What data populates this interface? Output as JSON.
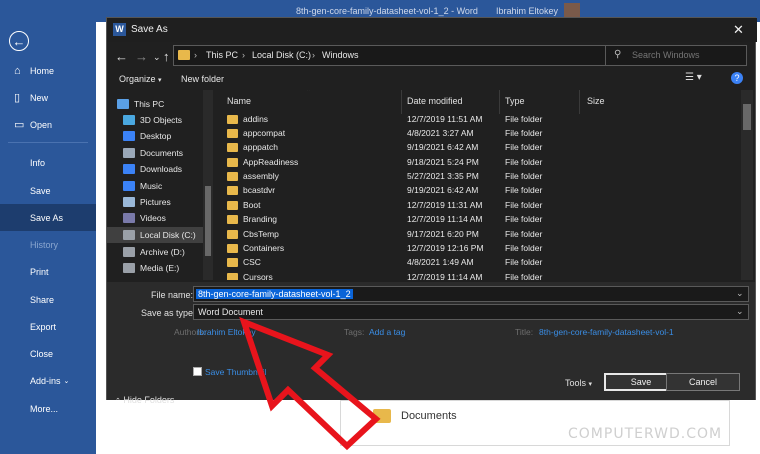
{
  "backstage": {
    "items": [
      {
        "label": "Home",
        "icon": "home-icon"
      },
      {
        "label": "New",
        "icon": "new-doc-icon"
      },
      {
        "label": "Open",
        "icon": "folder-open-icon"
      },
      {
        "label": "Info"
      },
      {
        "label": "Save"
      },
      {
        "label": "Save As"
      },
      {
        "label": "History"
      },
      {
        "label": "Print"
      },
      {
        "label": "Share"
      },
      {
        "label": "Export"
      },
      {
        "label": "Close"
      },
      {
        "label": "Add-ins"
      },
      {
        "label": "More..."
      }
    ],
    "active": "Save As",
    "accent": "#2b579a"
  },
  "word": {
    "doc_title": "8th-gen-core-family-datasheet-vol-1_2 - Word",
    "user": "Ibrahim Eltokey",
    "documents_label": "Documents"
  },
  "watermark": "COMPUTERWD.COM",
  "dialog": {
    "title": "Save As",
    "breadcrumb": [
      "This PC",
      "Local Disk (C:)",
      "Windows"
    ],
    "search_placeholder": "Search Windows",
    "organize": "Organize",
    "new_folder": "New folder",
    "nav": [
      {
        "label": "This PC",
        "color": "#5aa0e6"
      },
      {
        "label": "3D Objects",
        "color": "#4aa8e0"
      },
      {
        "label": "Desktop",
        "color": "#3b82f6"
      },
      {
        "label": "Documents",
        "color": "#9aa8b8"
      },
      {
        "label": "Downloads",
        "color": "#3b82f6"
      },
      {
        "label": "Music",
        "color": "#3b82f6"
      },
      {
        "label": "Pictures",
        "color": "#9ab8d8"
      },
      {
        "label": "Videos",
        "color": "#7a7aaa"
      },
      {
        "label": "Local Disk (C:)",
        "color": "#9aa0a8"
      },
      {
        "label": "Archive (D:)",
        "color": "#9aa0a8"
      },
      {
        "label": "Media (E:)",
        "color": "#9aa0a8"
      }
    ],
    "selected_nav": "Local Disk (C:)",
    "columns": [
      "Name",
      "Date modified",
      "Type",
      "Size"
    ],
    "files": [
      {
        "name": "addins",
        "date": "12/7/2019 11:51 AM",
        "type": "File folder"
      },
      {
        "name": "appcompat",
        "date": "4/8/2021 3:27 AM",
        "type": "File folder"
      },
      {
        "name": "apppatch",
        "date": "9/19/2021 6:42 AM",
        "type": "File folder"
      },
      {
        "name": "AppReadiness",
        "date": "9/18/2021 5:24 PM",
        "type": "File folder"
      },
      {
        "name": "assembly",
        "date": "5/27/2021 3:35 PM",
        "type": "File folder"
      },
      {
        "name": "bcastdvr",
        "date": "9/19/2021 6:42 AM",
        "type": "File folder"
      },
      {
        "name": "Boot",
        "date": "12/7/2019 11:31 AM",
        "type": "File folder"
      },
      {
        "name": "Branding",
        "date": "12/7/2019 11:14 AM",
        "type": "File folder"
      },
      {
        "name": "CbsTemp",
        "date": "9/17/2021 6:20 PM",
        "type": "File folder"
      },
      {
        "name": "Containers",
        "date": "12/7/2019 12:16 PM",
        "type": "File folder"
      },
      {
        "name": "CSC",
        "date": "4/8/2021 1:49 AM",
        "type": "File folder"
      },
      {
        "name": "Cursors",
        "date": "12/7/2019 11:14 AM",
        "type": "File folder"
      }
    ],
    "file_name_label": "File name:",
    "file_name": "8th-gen-core-family-datasheet-vol-1_2",
    "save_type_label": "Save as type:",
    "save_type": "Word Document",
    "authors_label": "Authors:",
    "authors": "Ibrahim Eltokey",
    "tags_label": "Tags:",
    "tags": "Add a tag",
    "title_label": "Title:",
    "title_value": "8th-gen-core-family-datasheet-vol-1",
    "thumbnail_label": "Save Thumbnail",
    "hide_folders": "Hide Folders",
    "tools": "Tools",
    "save": "Save",
    "cancel": "Cancel"
  },
  "annotation": {
    "color": "#e8141c",
    "icon": "red-arrow-icon"
  }
}
